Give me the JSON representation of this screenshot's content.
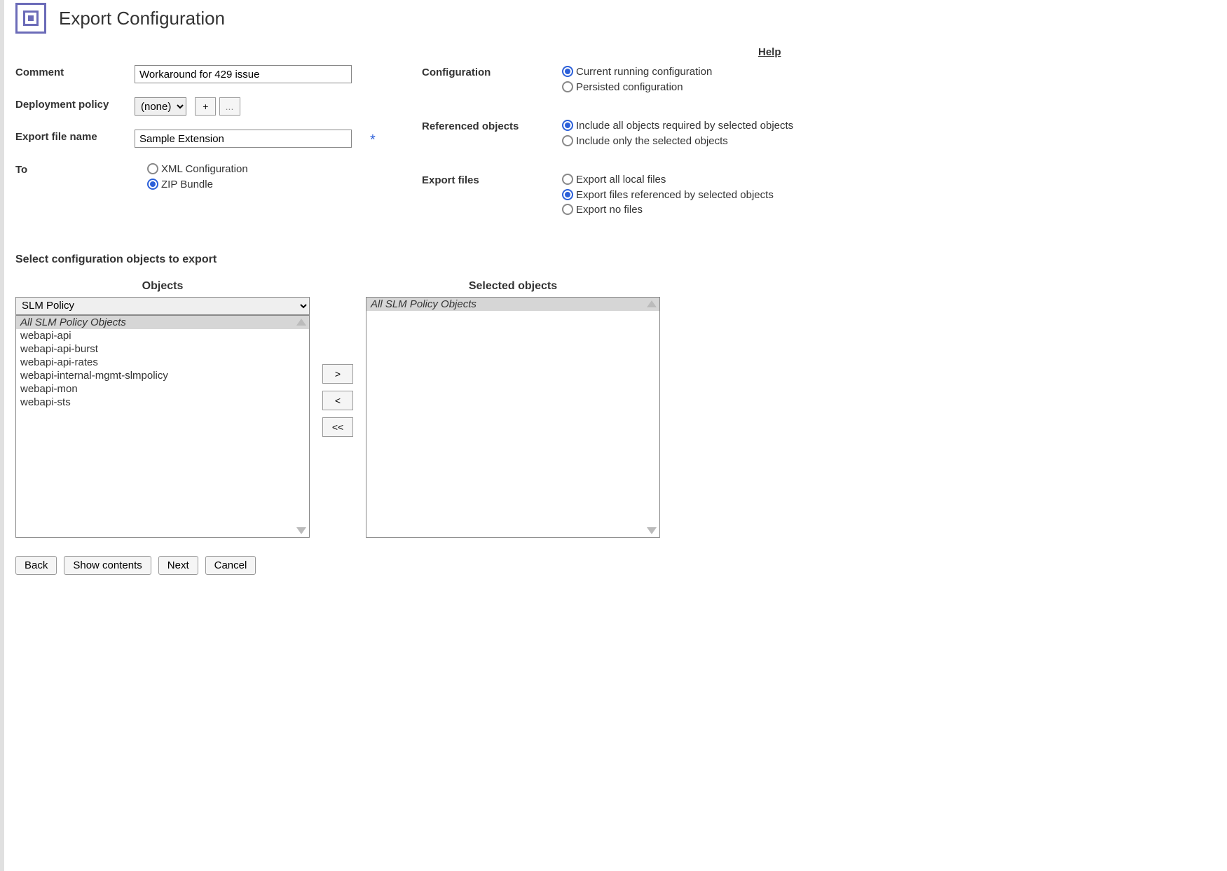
{
  "title": "Export Configuration",
  "help_label": "Help",
  "labels": {
    "comment": "Comment",
    "deployment_policy": "Deployment policy",
    "export_file_name": "Export file name",
    "to": "To",
    "configuration": "Configuration",
    "referenced_objects": "Referenced objects",
    "export_files": "Export files"
  },
  "fields": {
    "comment_value": "Workaround for 429 issue",
    "deployment_policy_value": "(none)",
    "deployment_policy_plus": "+",
    "deployment_policy_more": "...",
    "export_file_name_value": "Sample Extension",
    "required_mark": "*"
  },
  "to_options": {
    "xml": {
      "label": "XML Configuration",
      "selected": false
    },
    "zip": {
      "label": "ZIP Bundle",
      "selected": true
    }
  },
  "configuration_options": {
    "current": {
      "label": "Current running configuration",
      "selected": true
    },
    "persisted": {
      "label": "Persisted configuration",
      "selected": false
    }
  },
  "referenced_options": {
    "all": {
      "label": "Include all objects required by selected objects",
      "selected": true
    },
    "only": {
      "label": "Include only the selected objects",
      "selected": false
    }
  },
  "export_files_options": {
    "all": {
      "label": "Export all local files",
      "selected": false
    },
    "ref": {
      "label": "Export files referenced by selected objects",
      "selected": true
    },
    "none": {
      "label": "Export no files",
      "selected": false
    }
  },
  "section_header": "Select configuration objects to export",
  "objects_heading": "Objects",
  "selected_heading": "Selected objects",
  "objects_dropdown_value": "SLM Policy",
  "objects_list": [
    "All SLM Policy Objects",
    "webapi-api",
    "webapi-api-burst",
    "webapi-api-rates",
    "webapi-internal-mgmt-slmpolicy",
    "webapi-mon",
    "webapi-sts"
  ],
  "selected_list": [
    "All SLM Policy Objects"
  ],
  "move_buttons": {
    "right": ">",
    "left": "<",
    "left_all": "<<"
  },
  "buttons": {
    "back": "Back",
    "show_contents": "Show contents",
    "next": "Next",
    "cancel": "Cancel"
  }
}
